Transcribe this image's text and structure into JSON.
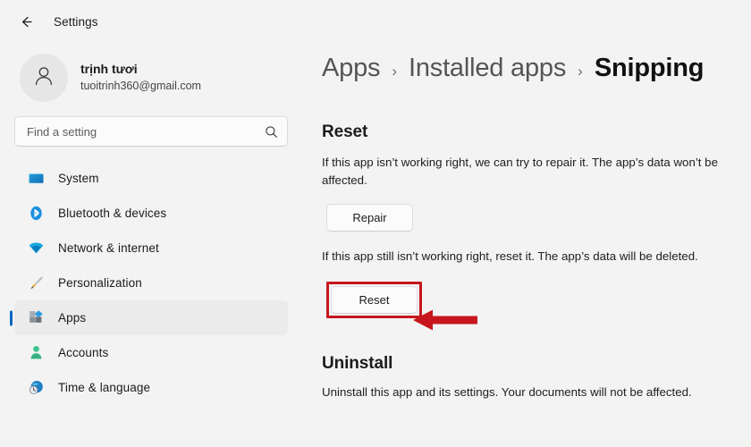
{
  "window": {
    "back_label": "back-arrow",
    "title": "Settings"
  },
  "account": {
    "name": "trịnh tươi",
    "email": "tuoitrinh360@gmail.com",
    "avatar_icon": "person-icon"
  },
  "search": {
    "placeholder": "Find a setting",
    "value": "",
    "icon": "search-icon"
  },
  "sidebar": {
    "items": [
      {
        "label": "System",
        "icon": "monitor-icon",
        "selected": false
      },
      {
        "label": "Bluetooth & devices",
        "icon": "bluetooth-icon",
        "selected": false
      },
      {
        "label": "Network & internet",
        "icon": "wifi-icon",
        "selected": false
      },
      {
        "label": "Personalization",
        "icon": "paintbrush-icon",
        "selected": false
      },
      {
        "label": "Apps",
        "icon": "apps-icon",
        "selected": true
      },
      {
        "label": "Accounts",
        "icon": "account-person-icon",
        "selected": false
      },
      {
        "label": "Time & language",
        "icon": "clock-globe-icon",
        "selected": false
      }
    ]
  },
  "breadcrumb": {
    "items": [
      "Apps",
      "Installed apps",
      "Snipping"
    ],
    "separator": "›",
    "current_index": 2
  },
  "reset_section": {
    "title": "Reset",
    "repair_description": "If this app isn’t working right, we can try to repair it. The app’s data won’t be affected.",
    "repair_button": "Repair",
    "reset_description": "If this app still isn’t working right, reset it. The app’s data will be deleted.",
    "reset_button": "Reset"
  },
  "uninstall_section": {
    "title": "Uninstall",
    "description": "Uninstall this app and its settings. Your documents will not be affected."
  },
  "annotation": {
    "highlight_color": "#c7161d",
    "arrow_color": "#c7161d",
    "arrow_direction": "left",
    "target": "reset-button"
  },
  "colors": {
    "accent": "#0067c0",
    "page_background": "#f3f3f3",
    "selected_item_background": "#ebebeb"
  }
}
